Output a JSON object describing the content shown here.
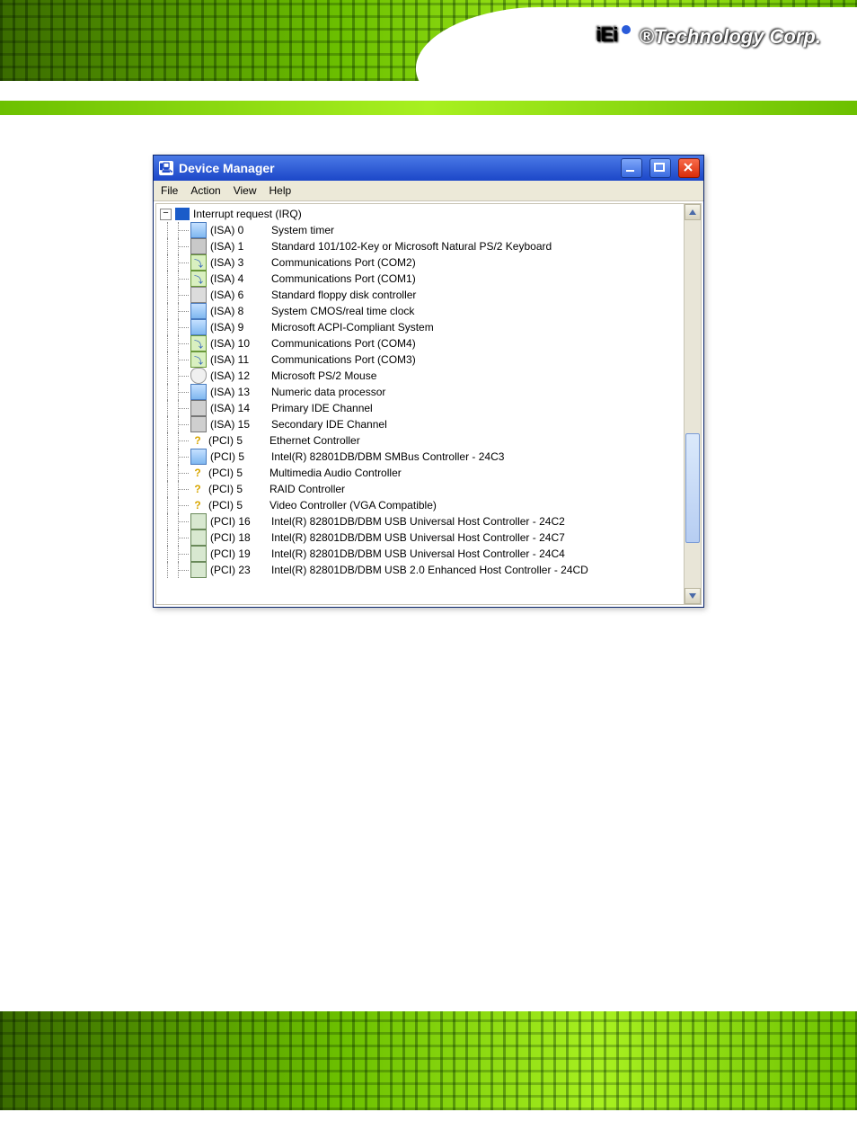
{
  "brand_text": "®Technology Corp.",
  "window": {
    "title": "Device Manager",
    "menu": {
      "file": "File",
      "action": "Action",
      "view": "View",
      "help": "Help"
    }
  },
  "tree": {
    "root": "Interrupt request (IRQ)",
    "items": [
      {
        "icon": "ic-chip",
        "bus": "(ISA)  0",
        "name": "System timer"
      },
      {
        "icon": "ic-kb",
        "bus": "(ISA)  1",
        "name": "Standard 101/102-Key or Microsoft Natural PS/2 Keyboard"
      },
      {
        "icon": "ic-port",
        "bus": "(ISA)  3",
        "name": "Communications Port (COM2)"
      },
      {
        "icon": "ic-port",
        "bus": "(ISA)  4",
        "name": "Communications Port (COM1)"
      },
      {
        "icon": "ic-fdd",
        "bus": "(ISA)  6",
        "name": "Standard floppy disk controller"
      },
      {
        "icon": "ic-chip",
        "bus": "(ISA)  8",
        "name": "System CMOS/real time clock"
      },
      {
        "icon": "ic-chip",
        "bus": "(ISA)  9",
        "name": "Microsoft ACPI-Compliant System"
      },
      {
        "icon": "ic-port",
        "bus": "(ISA) 10",
        "name": "Communications Port (COM4)"
      },
      {
        "icon": "ic-port",
        "bus": "(ISA) 11",
        "name": "Communications Port (COM3)"
      },
      {
        "icon": "ic-mouse",
        "bus": "(ISA) 12",
        "name": "Microsoft PS/2 Mouse"
      },
      {
        "icon": "ic-chip",
        "bus": "(ISA) 13",
        "name": "Numeric data processor"
      },
      {
        "icon": "ic-ide",
        "bus": "(ISA) 14",
        "name": "Primary IDE Channel"
      },
      {
        "icon": "ic-ide",
        "bus": "(ISA) 15",
        "name": "Secondary IDE Channel"
      },
      {
        "icon": "ic-warn",
        "bus": "(PCI)  5",
        "name": "Ethernet Controller"
      },
      {
        "icon": "ic-chip",
        "bus": "(PCI)  5",
        "name": "Intel(R) 82801DB/DBM SMBus Controller - 24C3"
      },
      {
        "icon": "ic-warn",
        "bus": "(PCI)  5",
        "name": "Multimedia Audio Controller"
      },
      {
        "icon": "ic-warn",
        "bus": "(PCI)  5",
        "name": "RAID Controller"
      },
      {
        "icon": "ic-warn",
        "bus": "(PCI)  5",
        "name": "Video Controller (VGA Compatible)"
      },
      {
        "icon": "ic-usb",
        "bus": "(PCI) 16",
        "name": "Intel(R) 82801DB/DBM USB Universal Host Controller - 24C2"
      },
      {
        "icon": "ic-usb",
        "bus": "(PCI) 18",
        "name": "Intel(R) 82801DB/DBM USB Universal Host Controller - 24C7"
      },
      {
        "icon": "ic-usb",
        "bus": "(PCI) 19",
        "name": "Intel(R) 82801DB/DBM USB Universal Host Controller - 24C4"
      },
      {
        "icon": "ic-usb",
        "bus": "(PCI) 23",
        "name": "Intel(R) 82801DB/DBM USB 2.0 Enhanced Host Controller - 24CD"
      }
    ]
  }
}
